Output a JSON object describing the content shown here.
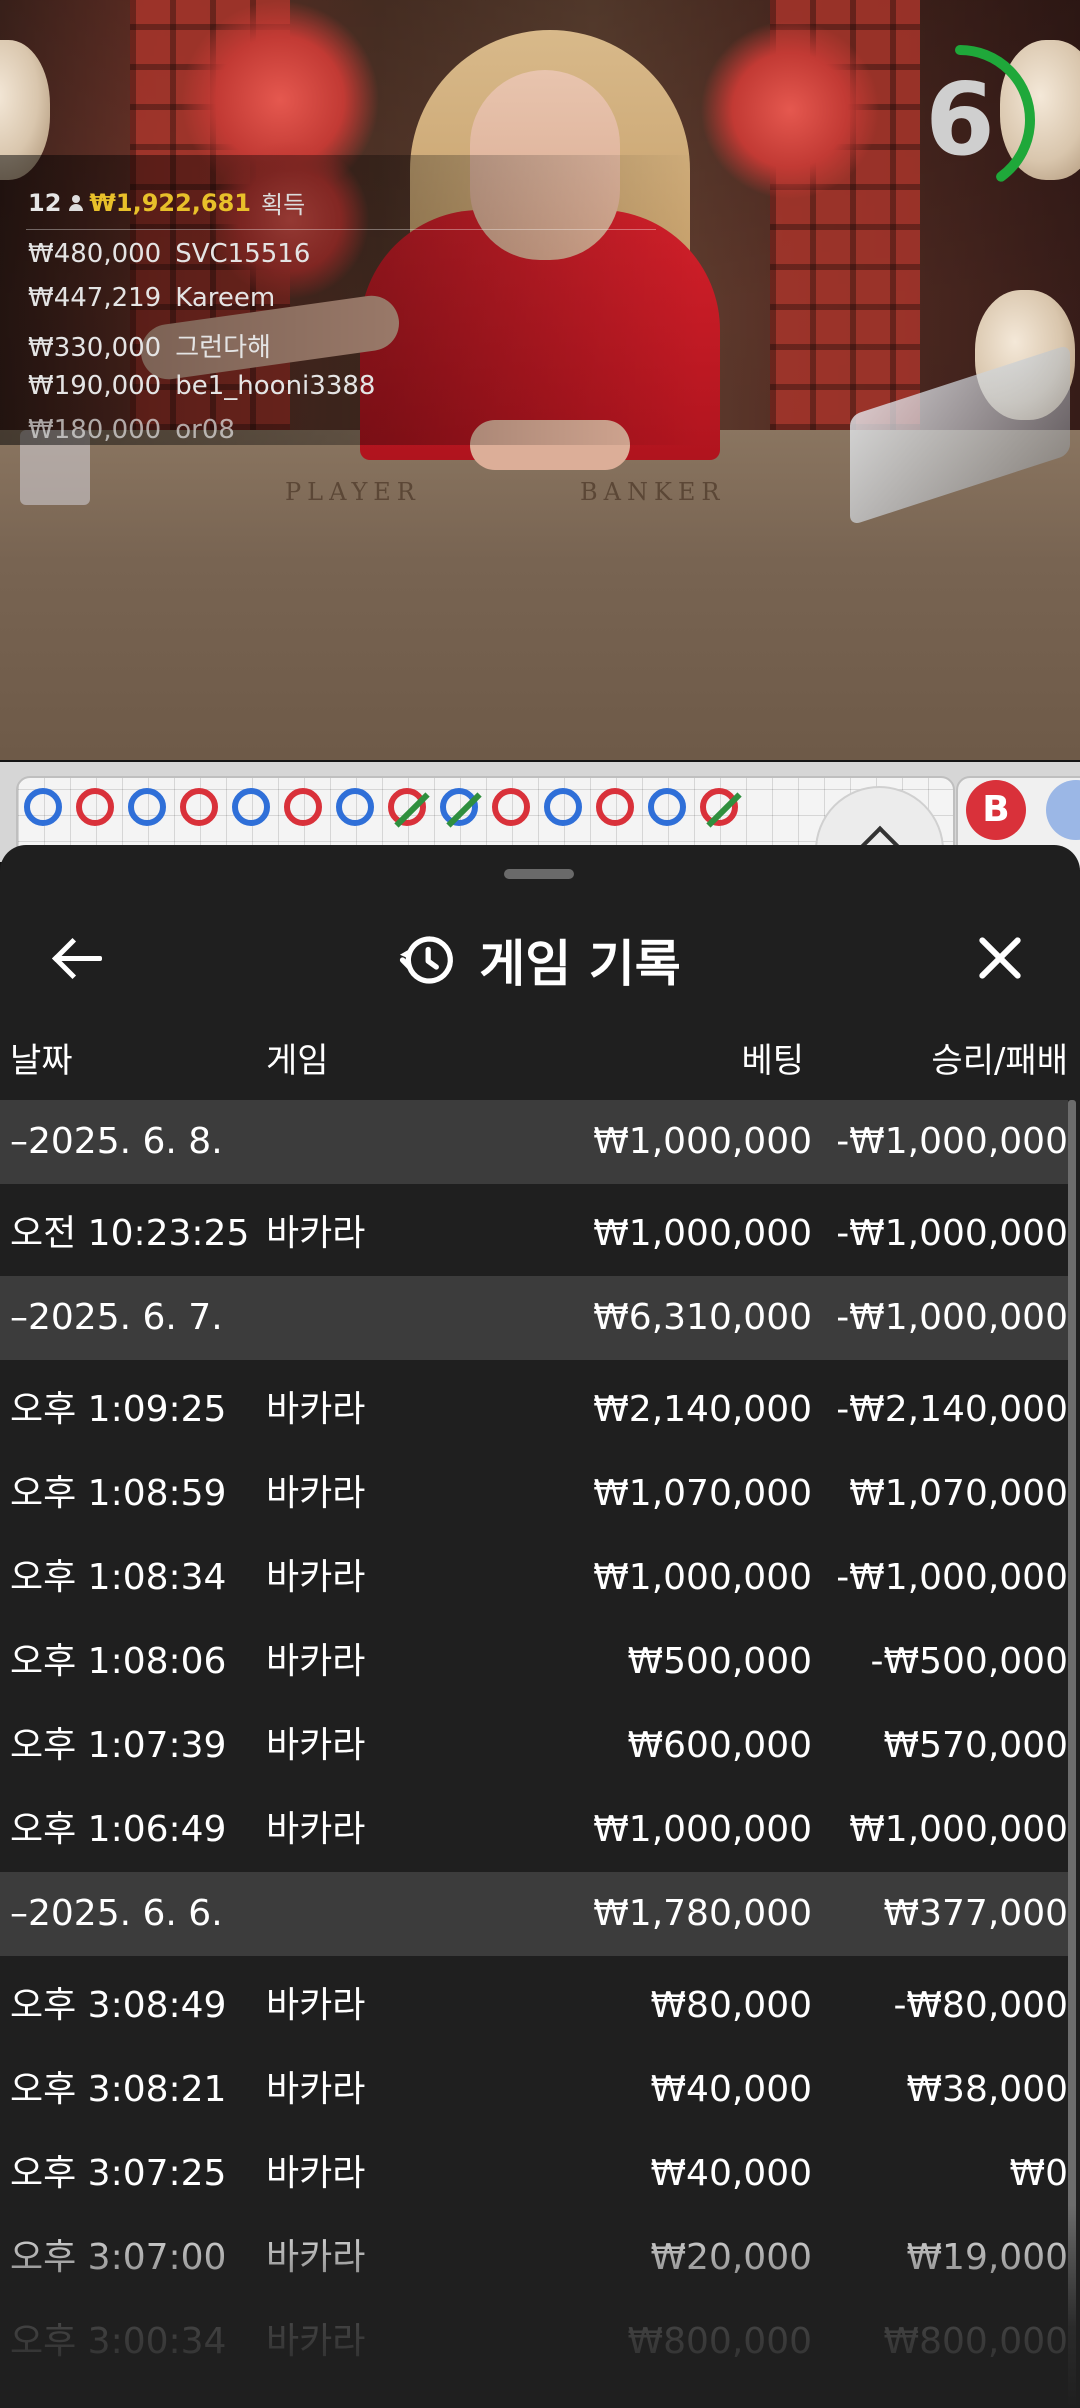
{
  "leaderboard": {
    "player_count": "12",
    "total_win": "₩1,922,681",
    "win_label": "획득",
    "entries": [
      {
        "amount": "₩480,000",
        "name": "SVC15516"
      },
      {
        "amount": "₩447,219",
        "name": "Kareem"
      },
      {
        "amount": "₩330,000",
        "name": "그런다해"
      },
      {
        "amount": "₩190,000",
        "name": "be1_hooni3388"
      },
      {
        "amount": "₩180,000",
        "name": "or08"
      }
    ]
  },
  "timer": {
    "value": "6",
    "remaining_fraction": 0.4,
    "color": "#1fa83a"
  },
  "table_labels": {
    "player": "PLAYER",
    "banker": "BANKER"
  },
  "road": {
    "beads": [
      "p",
      "b",
      "p",
      "b",
      "p",
      "b",
      "p",
      "b-tie",
      "p-tie",
      "b",
      "p",
      "b",
      "p",
      "b-tie"
    ],
    "banker_button": "B",
    "colors": {
      "player": "#2f6fd8",
      "banker": "#d9313a",
      "tie": "#2f8f3e"
    }
  },
  "sheet": {
    "title": "게임 기록",
    "icons": {
      "back": "arrow-left-icon",
      "history": "history-icon",
      "close": "close-icon"
    },
    "columns": {
      "date": "날짜",
      "game": "게임",
      "bet": "베팅",
      "winloss": "승리/패배"
    },
    "rows": [
      {
        "type": "date",
        "date": "–2025. 6. 8.",
        "game": "",
        "bet": "₩1,000,000",
        "winloss": "-₩1,000,000"
      },
      {
        "type": "game",
        "date": "오전 10:23:25",
        "game": "바카라",
        "bet": "₩1,000,000",
        "winloss": "-₩1,000,000"
      },
      {
        "type": "date",
        "date": "–2025. 6. 7.",
        "game": "",
        "bet": "₩6,310,000",
        "winloss": "-₩1,000,000"
      },
      {
        "type": "game",
        "date": "오후 1:09:25",
        "game": "바카라",
        "bet": "₩2,140,000",
        "winloss": "-₩2,140,000"
      },
      {
        "type": "game",
        "date": "오후 1:08:59",
        "game": "바카라",
        "bet": "₩1,070,000",
        "winloss": "₩1,070,000"
      },
      {
        "type": "game",
        "date": "오후 1:08:34",
        "game": "바카라",
        "bet": "₩1,000,000",
        "winloss": "-₩1,000,000"
      },
      {
        "type": "game",
        "date": "오후 1:08:06",
        "game": "바카라",
        "bet": "₩500,000",
        "winloss": "-₩500,000"
      },
      {
        "type": "game",
        "date": "오후 1:07:39",
        "game": "바카라",
        "bet": "₩600,000",
        "winloss": "₩570,000"
      },
      {
        "type": "game",
        "date": "오후 1:06:49",
        "game": "바카라",
        "bet": "₩1,000,000",
        "winloss": "₩1,000,000"
      },
      {
        "type": "date",
        "date": "–2025. 6. 6.",
        "game": "",
        "bet": "₩1,780,000",
        "winloss": "₩377,000"
      },
      {
        "type": "game",
        "date": "오후 3:08:49",
        "game": "바카라",
        "bet": "₩80,000",
        "winloss": "-₩80,000"
      },
      {
        "type": "game",
        "date": "오후 3:08:21",
        "game": "바카라",
        "bet": "₩40,000",
        "winloss": "₩38,000"
      },
      {
        "type": "game",
        "date": "오후 3:07:25",
        "game": "바카라",
        "bet": "₩40,000",
        "winloss": "₩0"
      },
      {
        "type": "game",
        "date": "오후 3:07:00",
        "game": "바카라",
        "bet": "₩20,000",
        "winloss": "₩19,000"
      },
      {
        "type": "game",
        "date": "오후 3:00:34",
        "game": "바카라",
        "bet": "₩800,000",
        "winloss": "₩800,000"
      }
    ]
  }
}
